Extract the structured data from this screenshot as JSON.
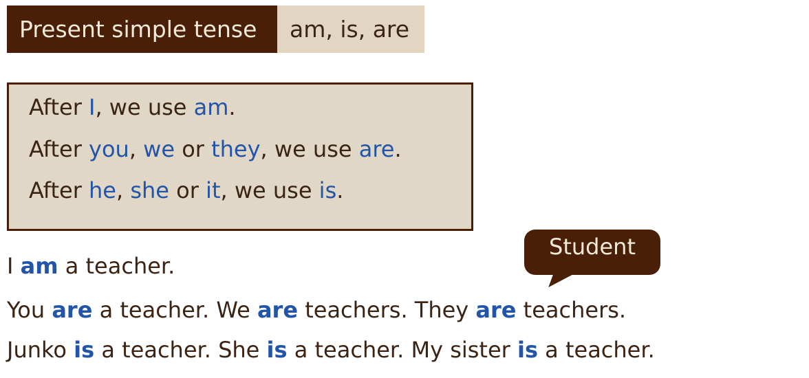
{
  "header": {
    "title": "Present simple tense",
    "subtitle": "am, is, are"
  },
  "rules": {
    "line1": {
      "after": "After ",
      "subject": "I",
      "mid": ", we use ",
      "verb": "am",
      "end": "."
    },
    "line2": {
      "after": "After ",
      "s1": "you",
      "c1": ", ",
      "s2": "we",
      "or": " or ",
      "s3": "they",
      "mid": ", we use ",
      "verb": "are",
      "end": "."
    },
    "line3": {
      "after": "After ",
      "s1": "he",
      "c1": ", ",
      "s2": "she",
      "or": " or ",
      "s3": "it",
      "mid": ", we use ",
      "verb": "is",
      "end": "."
    }
  },
  "examples": {
    "e1": {
      "a": "I ",
      "v1": "am",
      "b": " a teacher."
    },
    "e2": {
      "a": "You ",
      "v1": "are",
      "b": " a teacher. We ",
      "v2": "are",
      "c": " teachers. They ",
      "v3": "are",
      "d": " teachers."
    },
    "e3": {
      "a": "Junko ",
      "v1": "is",
      "b": " a teacher. She ",
      "v2": "is",
      "c": " a teacher. My sister ",
      "v3": "is",
      "d": " a teacher."
    }
  },
  "bubble": {
    "label": "Student"
  },
  "colors": {
    "brown": "#4a1f08",
    "beige": "#e0d7c6",
    "blue": "#2255a8",
    "text": "#3c2415"
  }
}
